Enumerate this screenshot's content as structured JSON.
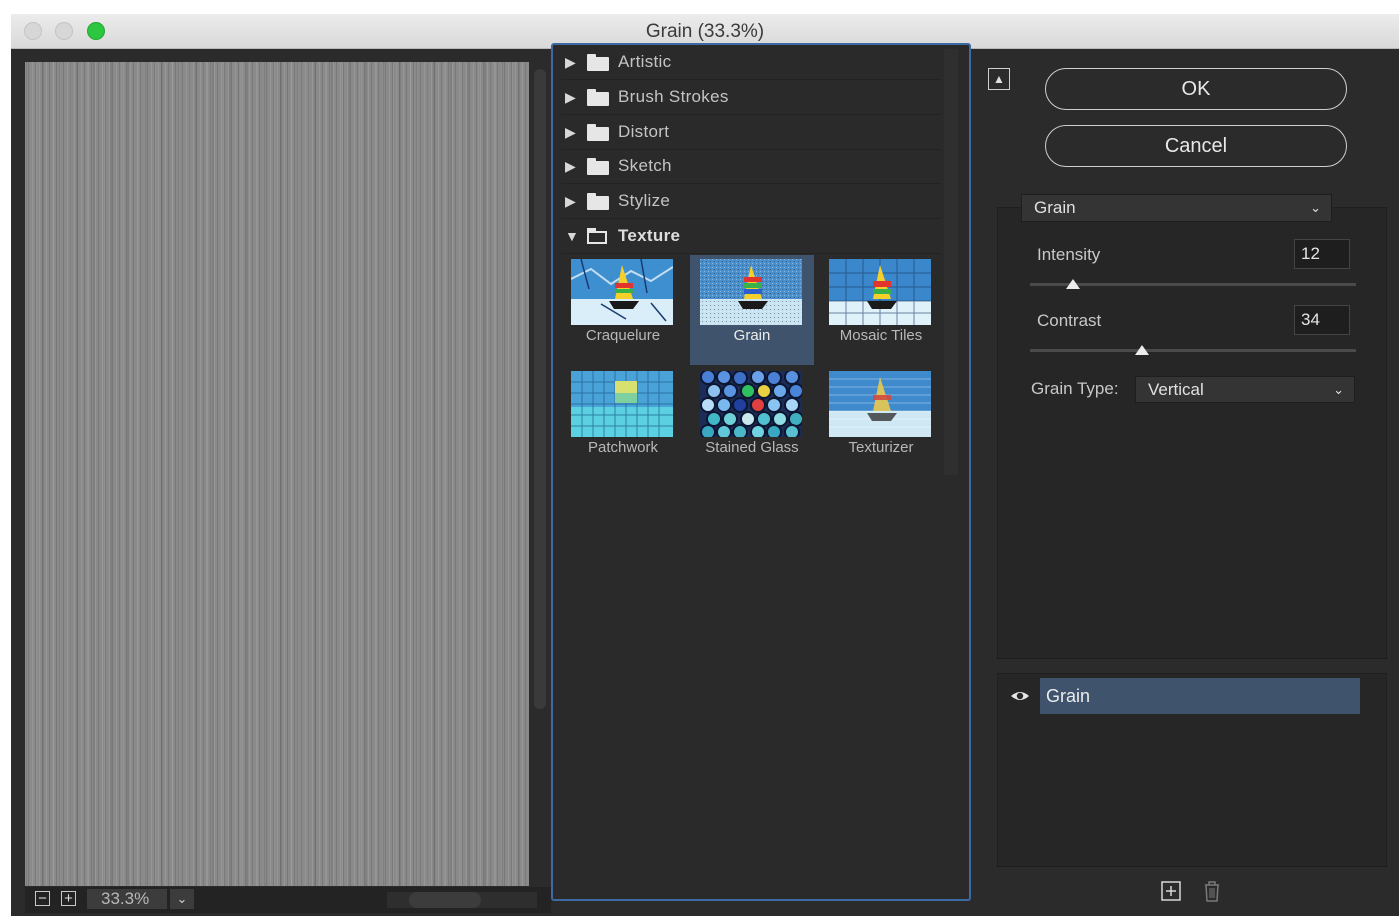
{
  "window": {
    "title": "Grain (33.3%)"
  },
  "preview": {
    "zoom": "33.3%",
    "zoom_out_symbol": "−",
    "zoom_in_symbol": "+"
  },
  "gallery": {
    "categories": [
      {
        "label": "Artistic",
        "expanded": false
      },
      {
        "label": "Brush Strokes",
        "expanded": false
      },
      {
        "label": "Distort",
        "expanded": false
      },
      {
        "label": "Sketch",
        "expanded": false
      },
      {
        "label": "Stylize",
        "expanded": false
      },
      {
        "label": "Texture",
        "expanded": true
      }
    ],
    "texture_filters": [
      {
        "label": "Craquelure",
        "selected": false
      },
      {
        "label": "Grain",
        "selected": true
      },
      {
        "label": "Mosaic Tiles",
        "selected": false
      },
      {
        "label": "Patchwork",
        "selected": false
      },
      {
        "label": "Stained Glass",
        "selected": false
      },
      {
        "label": "Texturizer",
        "selected": false
      }
    ]
  },
  "buttons": {
    "ok": "OK",
    "cancel": "Cancel"
  },
  "settings": {
    "filter": "Grain",
    "intensity": {
      "label": "Intensity",
      "value": "12"
    },
    "contrast": {
      "label": "Contrast",
      "value": "34"
    },
    "grain_type": {
      "label": "Grain Type:",
      "value": "Vertical"
    }
  },
  "layers": [
    {
      "label": "Grain",
      "visible": true
    }
  ],
  "colors": {
    "accent": "#3d6aa3",
    "selection": "#3f536d",
    "zoom_button": "#2dc640"
  },
  "icons": {
    "collapse": "collapse-up-icon",
    "visibility": "eye-icon",
    "new_layer": "new-effect-layer-icon",
    "delete_layer": "trash-icon"
  }
}
